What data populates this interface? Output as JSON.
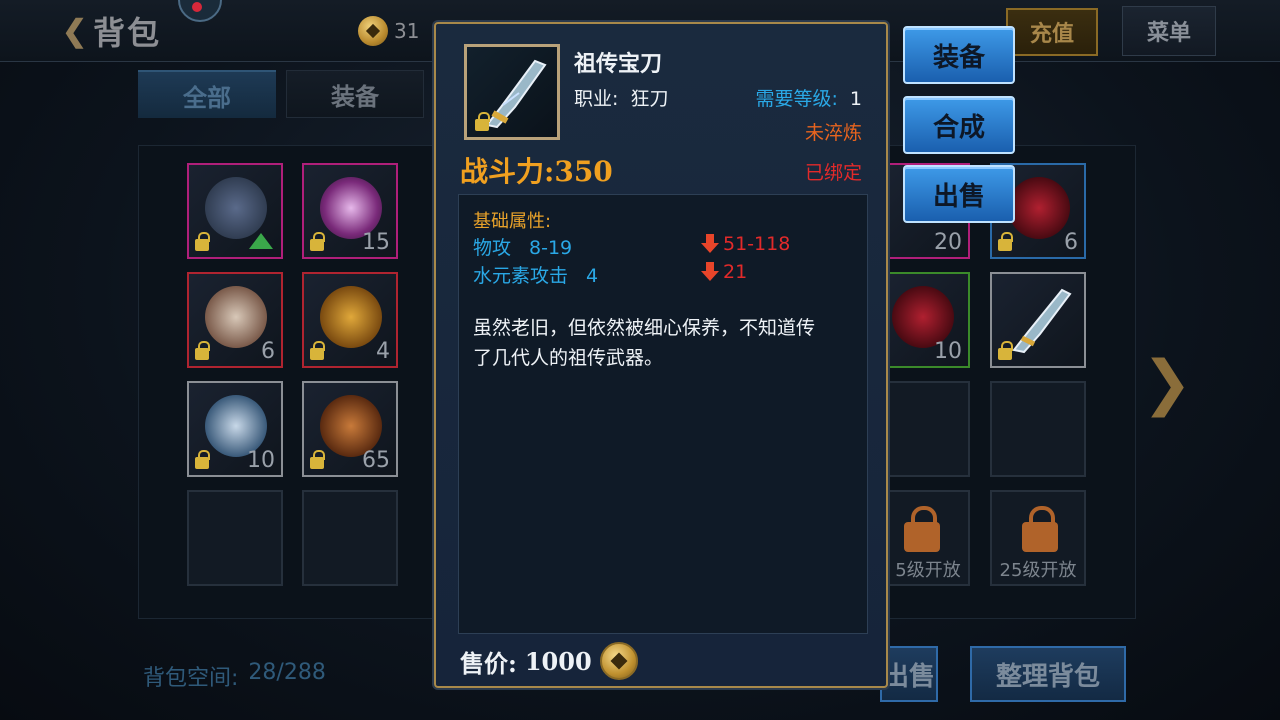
{
  "header": {
    "title": "背包",
    "currency_value": "31",
    "recharge_label": "充值",
    "menu_label": "菜单"
  },
  "tabs": [
    {
      "label": "全部",
      "active": true
    },
    {
      "label": "装备",
      "active": false
    }
  ],
  "inventory": {
    "counts": {
      "r1c2": "15",
      "r1c7": "20",
      "r1c8": "6",
      "r2c1": "6",
      "r2c2": "4",
      "r2c7": "10",
      "r3c1": "10",
      "r3c2": "65"
    },
    "locked_slot_text": "25级开放",
    "locked_slot_text_partial": "5级开放",
    "bag_space_label": "背包空间:",
    "bag_space_value": "28/288"
  },
  "bottom_buttons": {
    "sell_label": "出售",
    "organize_label": "整理背包"
  },
  "tooltip": {
    "item_name": "祖传宝刀",
    "job_label": "职业:",
    "job_value": "狂刀",
    "req_level_label": "需要等级:",
    "req_level_value": "1",
    "refine_status": "未淬炼",
    "bound_status": "已绑定",
    "power_label": "战斗力:",
    "power_value": "350",
    "attr_title": "基础属性:",
    "attributes": [
      {
        "name": "物攻",
        "value": "8-19",
        "compare": "51-118"
      },
      {
        "name": "水元素攻击",
        "value": "4",
        "compare": "21"
      }
    ],
    "description": "虽然老旧，但依然被细心保养，不知道传了几代人的祖传武器。",
    "sell_label": "售价:",
    "sell_value": "1000"
  },
  "actions": {
    "equip_label": "装备",
    "combine_label": "合成",
    "sell_label": "出售"
  },
  "colors": {
    "accent_gold": "#f0a020",
    "stat_blue": "#2aa8e6",
    "warn_red": "#e22a2a",
    "refine_orange": "#e8641e"
  }
}
